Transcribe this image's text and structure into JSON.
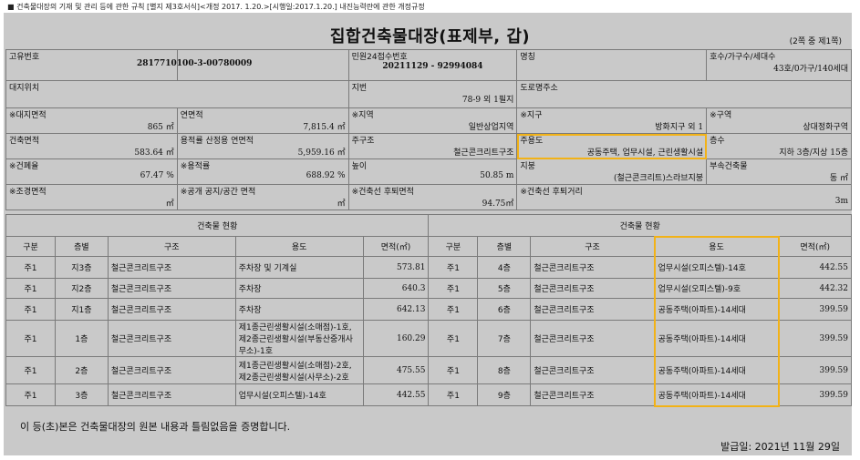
{
  "doc": {
    "regulation": "■ 건축물대장의 기재 및 관리 등에 관한 규칙 [별지 제3호서식]<개정 2017. 1.20.>[시행일:2017.1.20.] 내진능력란에 관한 개정규정",
    "title": "집합건축물대장(표제부, 갑)",
    "page_info": "(2쪽 중 제1쪽)",
    "certify_text": "이 등(초)본은 건축물대장의 원본 내용과 틀림없음을 증명합니다.",
    "issue_date": "발급일: 2021년 11월 29일"
  },
  "info": {
    "unique_no_label": "고유번호",
    "unique_no": "2817710100-3-00780009",
    "petition_label": "민원24접수번호",
    "petition_no": "20211129 - 92994084",
    "name_label": "명칭",
    "name": "",
    "units_label": "호수/가구수/세대수",
    "units": "43호/0가구/140세대",
    "location_label": "대지위치",
    "location": "",
    "lot_label": "지번",
    "lot": "78-9 외 1필지",
    "road_label": "도로명주소",
    "road": "",
    "land_area_label": "※대지면적",
    "land_area": "865 ㎡",
    "total_area_label": "연면적",
    "total_area": "7,815.4 ㎡",
    "zone_label": "※지역",
    "zone": "일반상업지역",
    "district_label": "※지구",
    "district": "방화지구 외 1",
    "sector_label": "※구역",
    "sector": "상대정화구역",
    "building_area_label": "건축면적",
    "building_area": "583.64 ㎡",
    "far_area_label": "용적률 산정용 연면적",
    "far_area": "5,959.16 ㎡",
    "main_structure_label": "주구조",
    "main_structure": "철근콘크리트구조",
    "main_use_label": "주용도",
    "main_use": "공동주택, 업무시설, 근린생활시설",
    "floors_label": "층수",
    "floors": "지하 3층/지상 15층",
    "coverage_label": "※건폐율",
    "coverage": "67.47 %",
    "far_label": "※용적률",
    "far": "688.92 %",
    "height_label": "높이",
    "height": "50.85 m",
    "roof_label": "지붕",
    "roof": "(철근콘크리트)스라브지붕",
    "annex_label": "부속건축물",
    "annex": "동 ㎡",
    "landscape_label": "※조경면적",
    "landscape": "㎡",
    "open_space_label": "※공개 공지/공간 면적",
    "open_space": "㎡",
    "setback_area_label": "※건축선 후퇴면적",
    "setback_area": "94.75㎡",
    "setback_dist_label": "※건축선 후퇴거리",
    "setback_dist": "3m"
  },
  "status": {
    "title": "건축물 현황",
    "headers": [
      "구분",
      "층별",
      "구조",
      "용도",
      "면적(㎡)"
    ],
    "left_rows": [
      [
        "주1",
        "지3층",
        "철근콘크리트구조",
        "주차장 및 기계실",
        "573.81"
      ],
      [
        "주1",
        "지2층",
        "철근콘크리트구조",
        "주차장",
        "640.3"
      ],
      [
        "주1",
        "지1층",
        "철근콘크리트구조",
        "주차장",
        "642.13"
      ],
      [
        "주1",
        "1층",
        "철근콘크리트구조",
        "제1종근린생활시설(소매점)-1호, 제2종근린생활시설(부동산중개사무소)-1호",
        "160.29"
      ],
      [
        "주1",
        "2층",
        "철근콘크리트구조",
        "제1종근린생활시설(소매점)-2호, 제2종근린생활시설(사무소)-2호",
        "475.55"
      ],
      [
        "주1",
        "3층",
        "철근콘크리트구조",
        "업무시설(오피스텔)-14호",
        "442.55"
      ]
    ],
    "right_rows": [
      [
        "주1",
        "4층",
        "철근콘크리트구조",
        "업무시설(오피스텔)-14호",
        "442.55"
      ],
      [
        "주1",
        "5층",
        "철근콘크리트구조",
        "업무시설(오피스텔)-9호",
        "442.32"
      ],
      [
        "주1",
        "6층",
        "철근콘크리트구조",
        "공동주택(아파트)-14세대",
        "399.59"
      ],
      [
        "주1",
        "7층",
        "철근콘크리트구조",
        "공동주택(아파트)-14세대",
        "399.59"
      ],
      [
        "주1",
        "8층",
        "철근콘크리트구조",
        "공동주택(아파트)-14세대",
        "399.59"
      ],
      [
        "주1",
        "9층",
        "철근콘크리트구조",
        "공동주택(아파트)-14세대",
        "399.59"
      ]
    ]
  },
  "highlight_color": "#f2b217"
}
